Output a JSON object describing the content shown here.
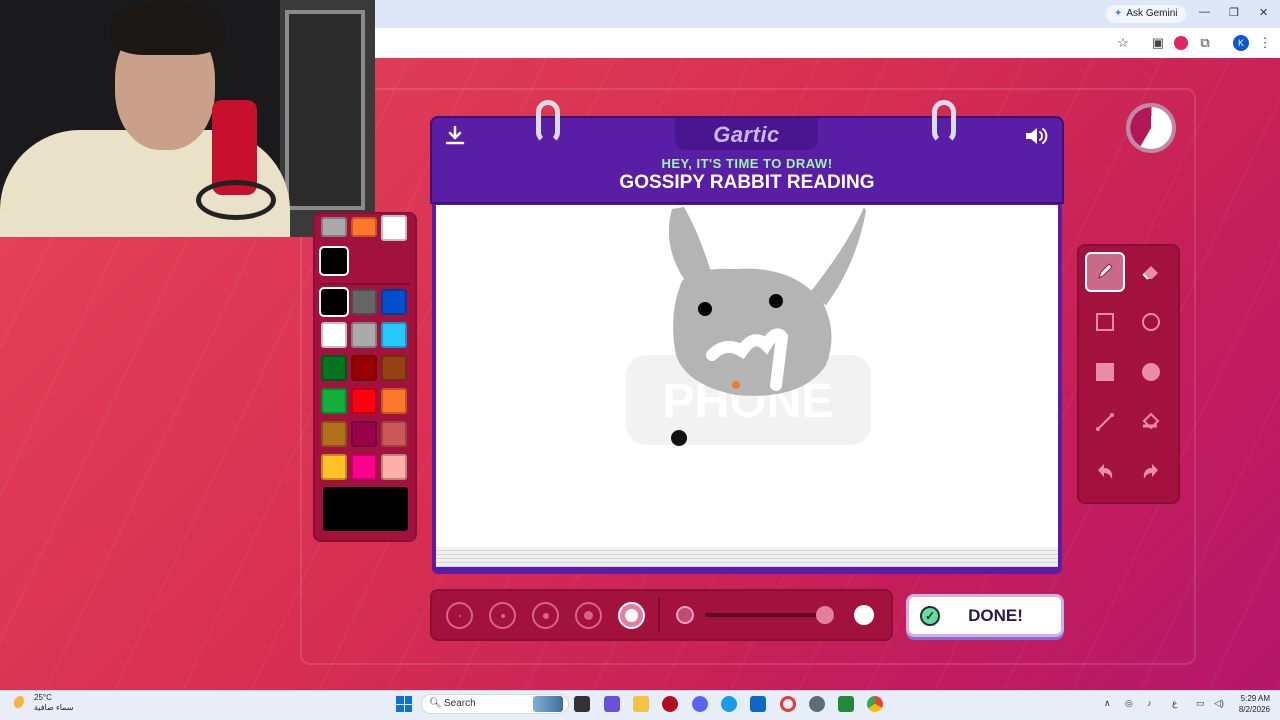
{
  "browser": {
    "gemini_label": "Ask Gemini",
    "profile_initial": "K"
  },
  "game": {
    "logo": "Gartic",
    "prompt_subtitle": "HEY, IT'S TIME TO DRAW!",
    "prompt_title": "GOSSIPY RABBIT READING",
    "done_label": "DONE!",
    "watermark": "PHONE",
    "timer_remaining_fraction": 0.42,
    "current_color": "#000000",
    "palette": [
      "#000000",
      "#666666",
      "#0050cd",
      "#ffffff",
      "#aaaaaa",
      "#26c9ff",
      "#017420",
      "#990000",
      "#964112",
      "#11b03c",
      "#ff0013",
      "#ff7829",
      "#b0701c",
      "#99004e",
      "#cb5a57",
      "#ffc126",
      "#ff008f",
      "#feafa8"
    ],
    "recent_colors": [
      "#aaaaaa",
      "#ff7829",
      "#ffffff",
      "#000000"
    ],
    "tools": [
      {
        "name": "pencil-tool",
        "active": true
      },
      {
        "name": "eraser-tool",
        "active": false
      },
      {
        "name": "rectangle-outline-tool",
        "active": false
      },
      {
        "name": "circle-outline-tool",
        "active": false
      },
      {
        "name": "rectangle-fill-tool",
        "active": false
      },
      {
        "name": "circle-fill-tool",
        "active": false
      },
      {
        "name": "line-tool",
        "active": false
      },
      {
        "name": "fill-bucket-tool",
        "active": false
      },
      {
        "name": "undo-tool",
        "active": false
      },
      {
        "name": "redo-tool",
        "active": false
      }
    ],
    "brush_sizes_selected_index": 4,
    "opacity_fraction": 0.92
  },
  "taskbar": {
    "weather_temp": "25°C",
    "weather_desc": "سماء صافية",
    "search_placeholder": "Search",
    "time": "5:29 AM",
    "date": "8/2/2026",
    "lang": "ع"
  }
}
